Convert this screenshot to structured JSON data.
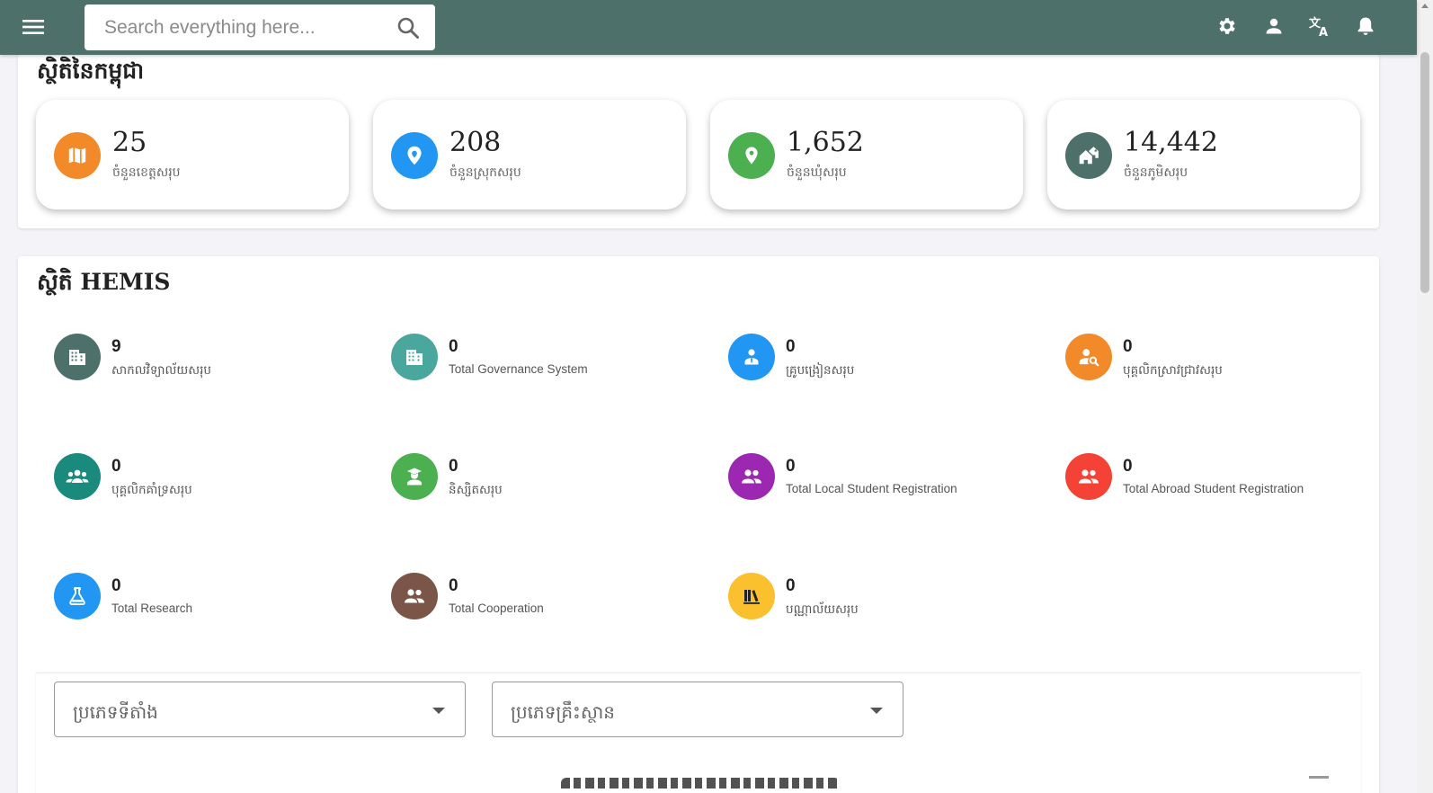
{
  "search": {
    "placeholder": "Search everything here..."
  },
  "icons": {
    "menu": "menu-icon",
    "search": "search-icon",
    "settings": "gear-icon",
    "account": "person-icon",
    "language": "translate-icon",
    "notifications": "bell-icon"
  },
  "colors": {
    "topbar": "#4e706b",
    "orange": "#f38a2a",
    "blue": "#2196f3",
    "green": "#4caf50",
    "slate": "#4e706b",
    "teal": "#4aa79e",
    "dark_teal": "#1a8a7c",
    "purple": "#9c27b0",
    "red": "#f44336",
    "brown": "#7b5548",
    "amber": "#fbc02d"
  },
  "cambodia_stats": {
    "title": "ស្ថិតិនៃកម្ពុជា",
    "cards": [
      {
        "value": "25",
        "label": "ចំនួនខេត្តសរុប",
        "icon": "map-icon"
      },
      {
        "value": "208",
        "label": "ចំនួនស្រុកសរុប",
        "icon": "location-pin-icon"
      },
      {
        "value": "1,652",
        "label": "ចំនួនឃុំសរុប",
        "icon": "place-marker-icon"
      },
      {
        "value": "14,442",
        "label": "ចំនួនភូមិសរុប",
        "icon": "houses-icon"
      }
    ]
  },
  "hemis_stats": {
    "title": "ស្ថិតិ HEMIS",
    "items": [
      {
        "value": "9",
        "label": "សាកលវិទ្យាល័យសរុប",
        "icon": "building-icon"
      },
      {
        "value": "0",
        "label": "Total Governance System",
        "icon": "building-icon"
      },
      {
        "value": "0",
        "label": "គ្រូបង្រៀនសរុប",
        "icon": "teacher-icon"
      },
      {
        "value": "0",
        "label": "បុគ្គលិកស្រាវជ្រាវសរុប",
        "icon": "person-search-icon"
      },
      {
        "value": "0",
        "label": "បុគ្គលិកគាំទ្រសរុប",
        "icon": "group-icon"
      },
      {
        "value": "0",
        "label": "និស្សិតសរុប",
        "icon": "graduate-icon"
      },
      {
        "value": "0",
        "label": "Total Local Student Registration",
        "icon": "people-icon"
      },
      {
        "value": "0",
        "label": "Total Abroad Student Registration",
        "icon": "people-icon"
      },
      {
        "value": "0",
        "label": "Total Research",
        "icon": "flask-icon"
      },
      {
        "value": "0",
        "label": "Total Cooperation",
        "icon": "people-icon"
      },
      {
        "value": "0",
        "label": "បណ្ណាល័យសរុប",
        "icon": "books-icon"
      }
    ]
  },
  "filters": {
    "location_type": "ប្រភេទទីតាំង",
    "institution_type": "ប្រភេទគ្រឹះស្ថាន"
  }
}
